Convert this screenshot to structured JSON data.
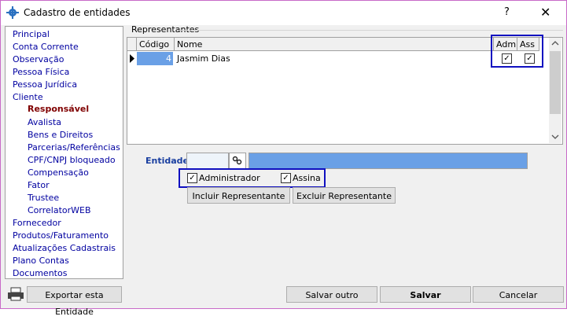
{
  "window": {
    "title": "Cadastro de entidades",
    "help": "?",
    "close": "✕"
  },
  "sidebar": {
    "items": [
      {
        "label": "Principal"
      },
      {
        "label": "Conta Corrente"
      },
      {
        "label": "Observação"
      },
      {
        "label": "Pessoa Física"
      },
      {
        "label": "Pessoa Jurídica"
      },
      {
        "label": "Cliente"
      },
      {
        "label": "Responsável"
      },
      {
        "label": "Avalista"
      },
      {
        "label": "Bens e Direitos"
      },
      {
        "label": "Parcerias/Referências"
      },
      {
        "label": "CPF/CNPJ bloqueado"
      },
      {
        "label": "Compensação"
      },
      {
        "label": "Fator"
      },
      {
        "label": "Trustee"
      },
      {
        "label": "CorrelatorWEB"
      },
      {
        "label": "Fornecedor"
      },
      {
        "label": "Produtos/Faturamento"
      },
      {
        "label": "Atualizações Cadastrais"
      },
      {
        "label": "Plano Contas"
      },
      {
        "label": "Documentos"
      }
    ]
  },
  "representantes": {
    "group_label": "Representantes",
    "headers": {
      "codigo": "Código",
      "nome": "Nome",
      "adm": "Adm",
      "ass": "Ass"
    },
    "rows": [
      {
        "codigo": "4",
        "nome": "Jasmim Dias",
        "adm": true,
        "ass": true
      }
    ]
  },
  "entidade": {
    "label": "Entidade",
    "code": "",
    "name": ""
  },
  "checks": {
    "administrador": "Administrador",
    "assina": "Assina",
    "check_mark": "✓"
  },
  "actions": {
    "incluir": "Incluir Representante",
    "excluir": "Excluir Representante"
  },
  "footer": {
    "exportar": "Exportar esta Entidade",
    "salvar_outro": "Salvar outro",
    "salvar": "Salvar",
    "cancelar": "Cancelar"
  },
  "colors": {
    "accent_blue": "#1010c0",
    "selected_fill": "#6aa0e6",
    "active_item": "#800000"
  }
}
